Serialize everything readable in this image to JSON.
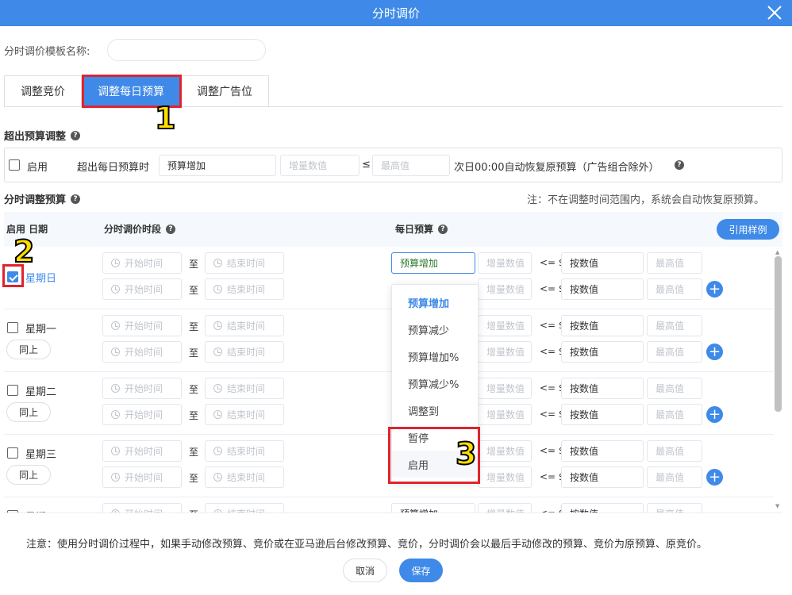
{
  "dialog": {
    "title": "分时调价",
    "close_icon": "close-icon"
  },
  "template_name": {
    "label": "分时调价模板名称:",
    "value": ""
  },
  "tabs": [
    {
      "label": "调整竞价",
      "active": false
    },
    {
      "label": "调整每日预算",
      "active": true
    },
    {
      "label": "调整广告位",
      "active": false
    }
  ],
  "over_budget": {
    "section_title": "超出预算调整",
    "enable_label": "启用",
    "when_label": "超出每日预算时",
    "select_value": "预算增加",
    "amount_placeholder": "增量数值",
    "le": "≤",
    "max_placeholder": "最高值",
    "note": "次日00:00自动恢复原预算（广告组合除外）"
  },
  "timed": {
    "section_title": "分时调整预算",
    "notice": "注：不在调整时间范围内，系统会自动恢复原预算。",
    "col_enable_date": "启用 日期",
    "col_period": "分时调价时段",
    "col_budget": "每日预算",
    "cite_button": "引用样例",
    "start_placeholder": "开始时间",
    "to": "至",
    "end_placeholder": "结束时间",
    "amount_placeholder": "增量数值",
    "le_dollar": "<= $",
    "by_value": "按数值",
    "max_placeholder": "最高值",
    "same_label": "同上",
    "select_value": "预算增加"
  },
  "days": [
    {
      "name": "星期日",
      "checked": true
    },
    {
      "name": "星期一",
      "checked": false
    },
    {
      "name": "星期二",
      "checked": false
    },
    {
      "name": "星期三",
      "checked": false
    },
    {
      "name": "星期四",
      "checked": false
    }
  ],
  "dropdown_options": [
    "预算增加",
    "预算减少",
    "预算增加%",
    "预算减少%",
    "调整到",
    "暂停",
    "启用"
  ],
  "footer": {
    "note": "注意：使用分时调价过程中，如果手动修改预算、竞价或在亚马逊后台修改预算、竞价，分时调价会以最后手动修改的预算、竞价为原预算、原竞价。",
    "cancel": "取消",
    "save": "保存"
  },
  "annotations": [
    "1",
    "2",
    "3"
  ],
  "colors": {
    "primary": "#3f8ae8",
    "highlight": "#e0232d",
    "badge": "#ffde00"
  }
}
